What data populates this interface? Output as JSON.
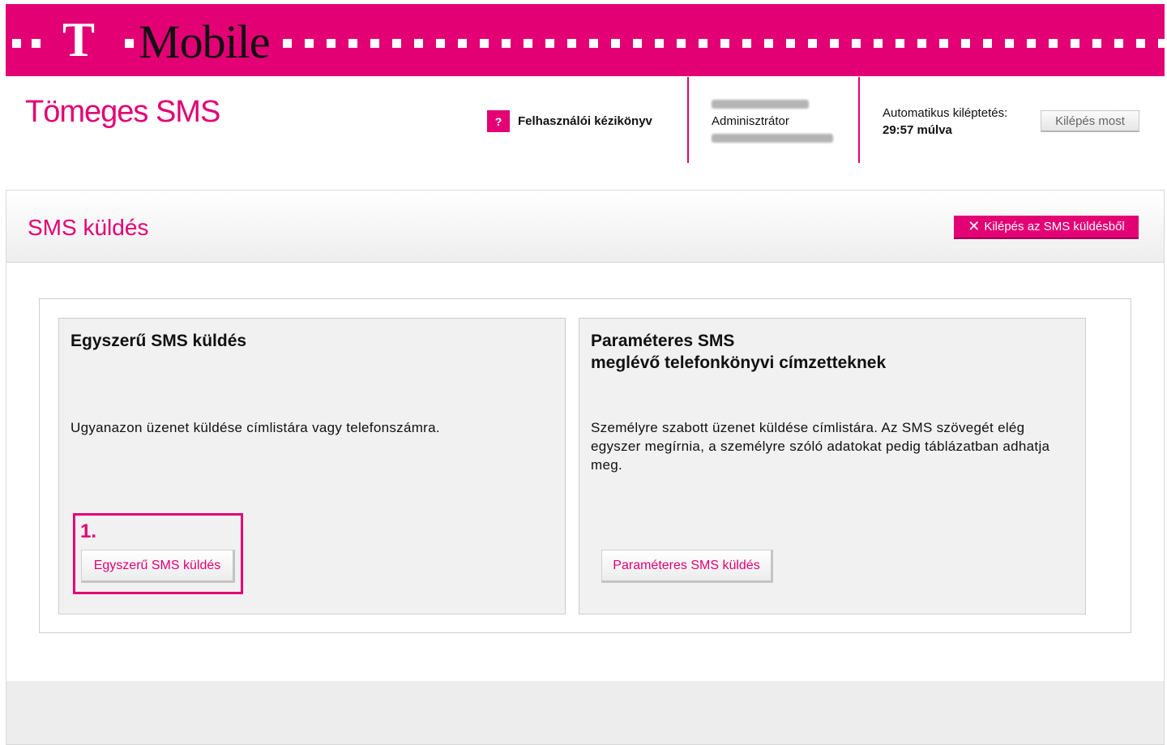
{
  "brand": {
    "logo_letter": "T",
    "name": "Mobile",
    "color": "#e20074"
  },
  "header": {
    "app_title": "Tömeges SMS",
    "help_icon": "?",
    "help_label": "Felhasználói kézikönyv",
    "user": {
      "role": "Adminisztrátor"
    },
    "logout": {
      "auto_label": "Automatikus kiléptetés:",
      "countdown": "29:57 múlva",
      "button_label": "Kilépés most"
    }
  },
  "panel": {
    "title": "SMS küldés",
    "exit_icon": "✕",
    "exit_label": "Kilépés az SMS küldésből"
  },
  "cards": [
    {
      "title": "Egyszerű SMS küldés",
      "description": "Ugyanazon üzenet küldése címlistára vagy telefonszámra.",
      "step_label": "1.",
      "button_label": "Egyszerű SMS küldés"
    },
    {
      "title_line1": "Paraméteres SMS",
      "title_line2": "meglévő telefonkönyvi címzetteknek",
      "description": "Személyre szabott üzenet küldése címlistára. Az SMS szövegét elég egyszer megírnia, a személyre szóló adatokat pedig táblázatban adhatja meg.",
      "button_label": "Paraméteres SMS küldés"
    }
  ]
}
